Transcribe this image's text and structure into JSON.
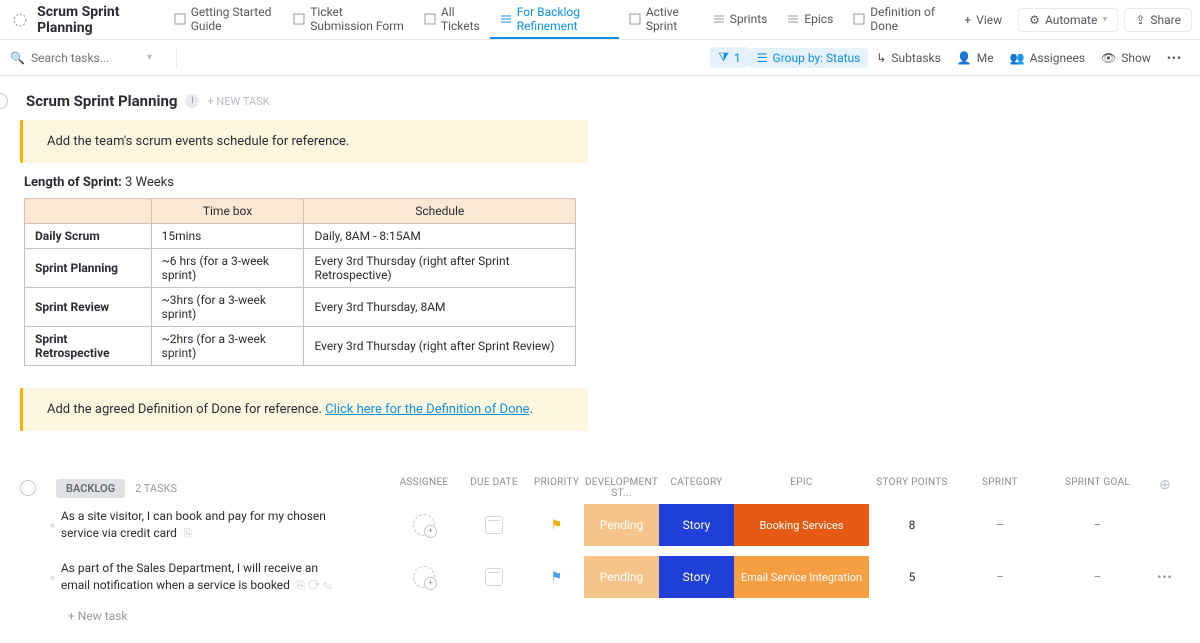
{
  "header": {
    "workspace_title": "Scrum Sprint Planning",
    "tabs": [
      {
        "label": "Getting Started Guide"
      },
      {
        "label": "Ticket Submission Form"
      },
      {
        "label": "All Tickets"
      },
      {
        "label": "For Backlog Refinement"
      },
      {
        "label": "Active Sprint"
      },
      {
        "label": "Sprints"
      },
      {
        "label": "Epics"
      },
      {
        "label": "Definition of Done"
      }
    ],
    "view_btn": "View",
    "automate_btn": "Automate",
    "share_btn": "Share"
  },
  "toolbar": {
    "search_placeholder": "Search tasks...",
    "filter_count": "1",
    "group_label": "Group by: Status",
    "subtasks": "Subtasks",
    "me": "Me",
    "assignees": "Assignees",
    "show": "Show"
  },
  "list": {
    "title": "Scrum Sprint Planning",
    "new_task_hint": "+ NEW TASK",
    "callout1": "Add the team's scrum events schedule for reference.",
    "length_label": "Length of Sprint:",
    "length_value": "3 Weeks",
    "table": {
      "headers": [
        "",
        "Time box",
        "Schedule"
      ],
      "rows": [
        [
          "Daily Scrum",
          "15mins",
          "Daily, 8AM - 8:15AM"
        ],
        [
          "Sprint Planning",
          "~6 hrs (for a 3-week sprint)",
          "Every 3rd Thursday (right after Sprint Retrospective)"
        ],
        [
          "Sprint Review",
          "~3hrs (for a 3-week sprint)",
          "Every 3rd Thursday, 8AM"
        ],
        [
          "Sprint Retrospective",
          "~2hrs (for a 3-week sprint)",
          "Every 3rd Thursday (right after Sprint Review)"
        ]
      ]
    },
    "callout2_pre": "Add the agreed Definition of Done for reference. ",
    "callout2_link": "Click here for the Definition of Done",
    "callout2_post": "."
  },
  "group": {
    "name": "BACKLOG",
    "count": "2 TASKS",
    "columns": [
      "ASSIGNEE",
      "DUE DATE",
      "PRIORITY",
      "DEVELOPMENT ST...",
      "CATEGORY",
      "EPIC",
      "STORY POINTS",
      "SPRINT",
      "SPRINT GOAL"
    ]
  },
  "tasks": [
    {
      "title": "As a site visitor, I can book and pay for my chosen service via credit card",
      "dev": "Pending",
      "cat": "Story",
      "epic": "Booking Services",
      "sp": "8",
      "sprint": "–",
      "goal": "–"
    },
    {
      "title": "As part of the Sales Department, I will receive an email notification when a service is booked",
      "dev": "Pending",
      "cat": "Story",
      "epic": "Email Service Integration",
      "sp": "5",
      "sprint": "–",
      "goal": "–"
    }
  ],
  "footer": {
    "new_task": "+ New task"
  }
}
